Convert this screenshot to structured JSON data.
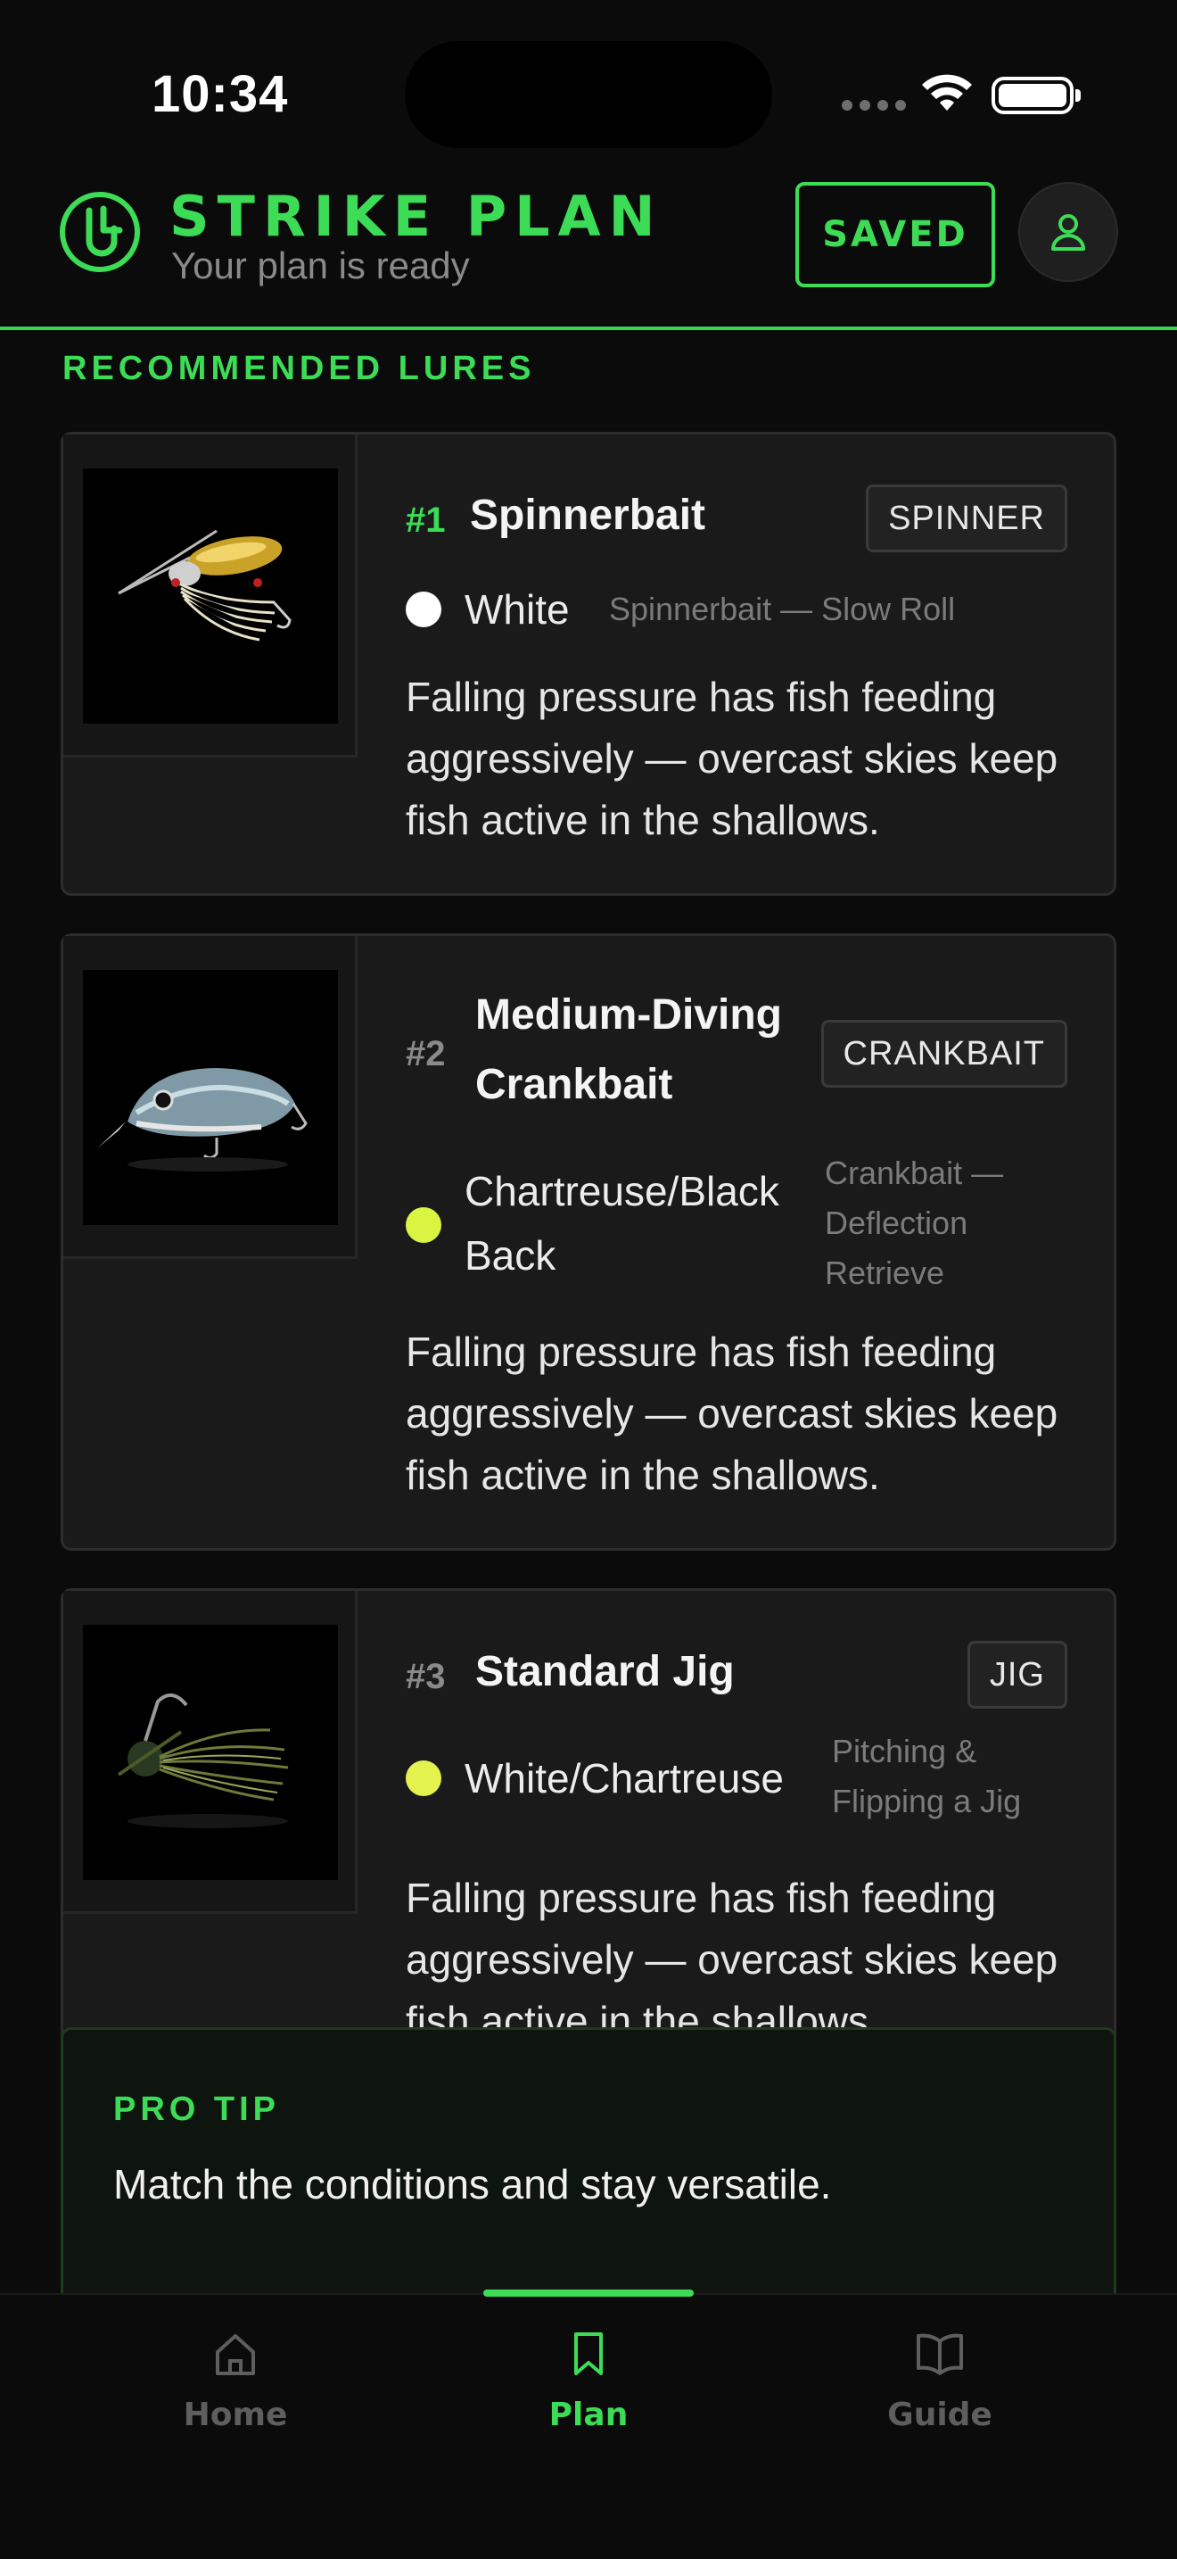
{
  "status_bar": {
    "time": "10:34"
  },
  "header": {
    "title": "STRIKE PLAN",
    "subtitle": "Your plan is ready",
    "saved_label": "SAVED"
  },
  "section_title": "RECOMMENDED LURES",
  "lures": [
    {
      "rank": "#1",
      "name": "Spinnerbait",
      "type": "SPINNER",
      "color_name": "White",
      "color_hex": "#ffffff",
      "technique": "Spinnerbait — Slow Roll",
      "reason": "Falling pressure has fish feeding aggressively — overcast skies keep fish active in the shallows."
    },
    {
      "rank": "#2",
      "name": "Medium-Diving Crankbait",
      "type": "CRANKBAIT",
      "color_name": "Chartreuse/Black Back",
      "color_hex": "#d9f542",
      "technique": "Crankbait — Deflection Retrieve",
      "reason": "Falling pressure has fish feeding aggressively — overcast skies keep fish active in the shallows."
    },
    {
      "rank": "#3",
      "name": "Standard Jig",
      "type": "JIG",
      "color_name": "White/Chartreuse",
      "color_hex": "#e4f24e",
      "technique": "Pitching & Flipping a Jig",
      "reason": "Falling pressure has fish feeding aggressively — overcast skies keep fish active in the shallows."
    }
  ],
  "pro_tip": {
    "label": "PRO TIP",
    "text": "Match the conditions and stay versatile."
  },
  "tabs": [
    {
      "label": "Home",
      "icon": "home-icon",
      "active": false
    },
    {
      "label": "Plan",
      "icon": "bookmark-icon",
      "active": true
    },
    {
      "label": "Guide",
      "icon": "book-icon",
      "active": false
    }
  ],
  "colors": {
    "accent": "#3ddc57",
    "background": "#0b0b0b",
    "card": "#1a1a1a"
  }
}
